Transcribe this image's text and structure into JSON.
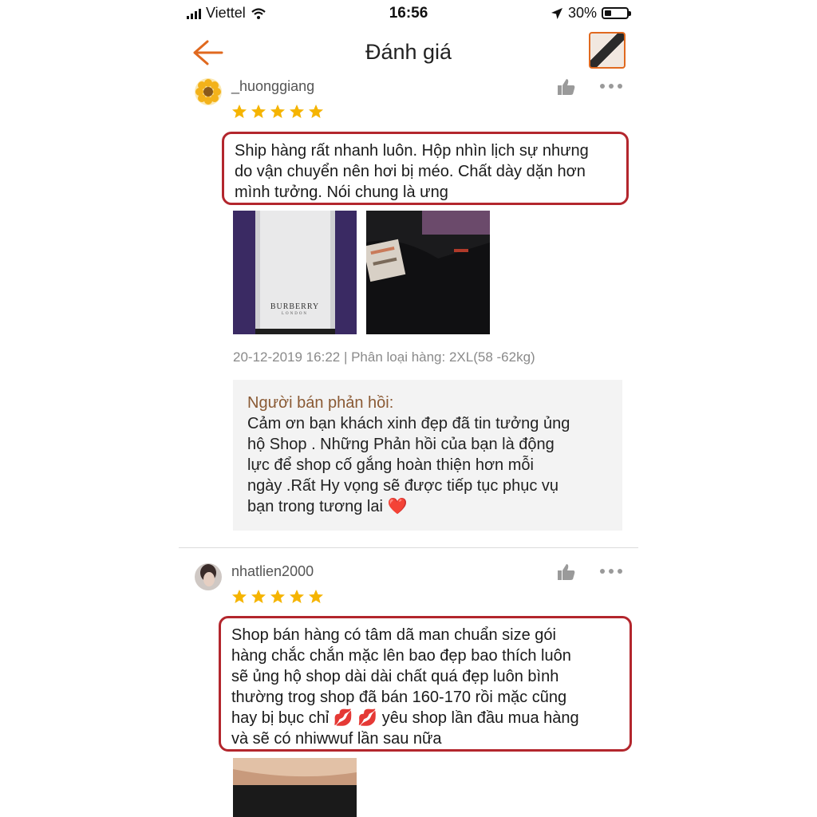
{
  "status_bar": {
    "carrier": "Viettel",
    "time": "16:56",
    "battery": "30%",
    "battery_level": 0.3
  },
  "navbar": {
    "title": "Đánh giá"
  },
  "reviews": [
    {
      "username": "_huonggiang",
      "rating": 5,
      "lines": [
        "Ship hàng rất nhanh luôn. Hộp nhìn lịch sự nhưng",
        "do vận chuyển nên hơi bị méo. Chất dày dặn hơn",
        "mình tưởng. Nói chung là ưng"
      ],
      "photo_text": "BURBERRY",
      "photo_subtext": "LONDON",
      "meta": "20-12-2019 16:22 | Phân loại hàng: 2XL(58 -62kg)",
      "seller_reply": {
        "title": "Người bán phản hồi:",
        "lines": [
          "Cảm ơn bạn khách xinh đẹp đã tin tưởng  ủng",
          "hộ Shop . Những Phản hồi của bạn là động",
          "lực để shop cố gắng hoàn thiện hơn mỗi",
          "ngày .Rất  Hy vọng sẽ được tiếp tục phục vụ",
          "bạn trong tương lai ❤️"
        ]
      }
    },
    {
      "username": "nhatlien2000",
      "rating": 5,
      "lines": [
        "Shop bán hàng có tâm dã man chuẩn size gói",
        "hàng chắc chắn mặc lên bao đẹp bao thích luôn",
        "sẽ ủng hộ shop dài dài chất quá đẹp luôn bình",
        "thường trog shop đã bán 160-170 rồi mặc cũng",
        "hay bị bục chỉ 💋 💋  yêu shop lần đầu mua hàng",
        "và sẽ có nhiwwuf lần sau nữa"
      ]
    }
  ],
  "colors": {
    "accent": "#e0691f",
    "highlight_border": "#b3262d",
    "star": "#f5b400",
    "seller_title": "#8a5a34"
  }
}
